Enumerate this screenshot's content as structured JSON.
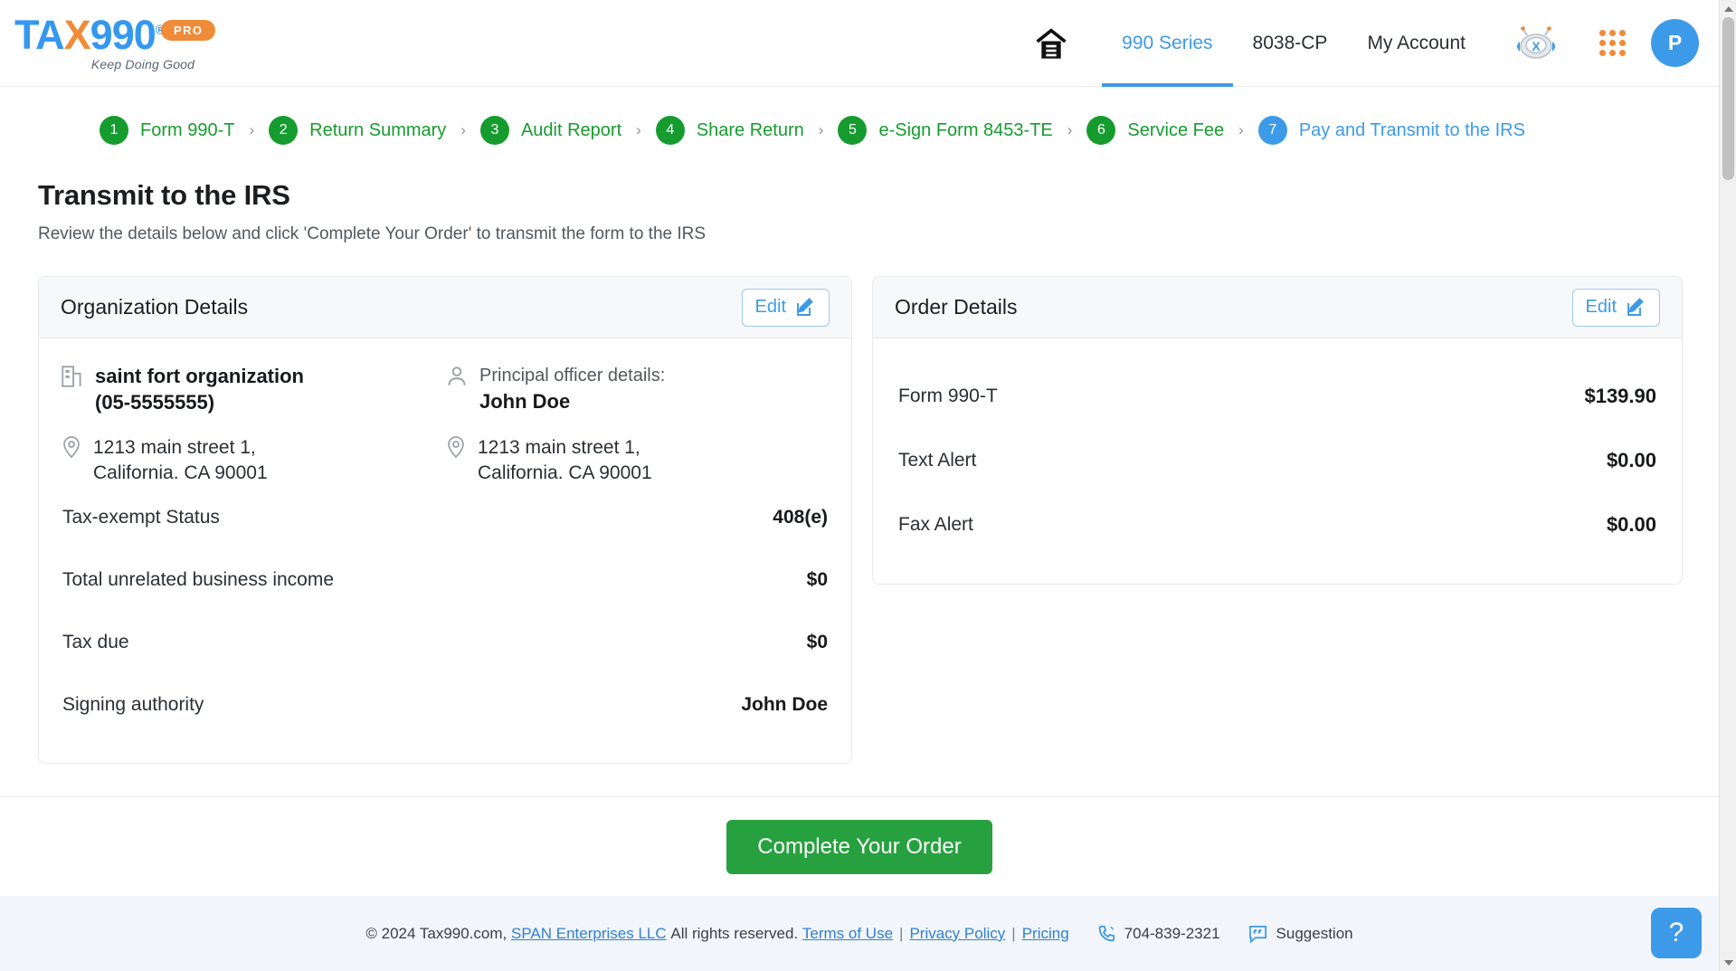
{
  "header": {
    "logo_text_1": "TA",
    "logo_text_x": "X",
    "logo_text_2": "990",
    "logo_reg": "®",
    "logo_tagline": "Keep Doing Good",
    "pro_badge": "PRO",
    "nav": [
      {
        "label": "990 Series",
        "active": true
      },
      {
        "label": "8038-CP",
        "active": false
      },
      {
        "label": "My Account",
        "active": false
      }
    ],
    "avatar_initial": "P",
    "home_icon": "home-icon",
    "bot_icon": "bot-assistant-icon",
    "apps_icon": "apps-grid-icon"
  },
  "stepper": {
    "steps": [
      {
        "number": "1",
        "label": "Form 990-T",
        "state": "done"
      },
      {
        "number": "2",
        "label": "Return Summary",
        "state": "done"
      },
      {
        "number": "3",
        "label": "Audit Report",
        "state": "done"
      },
      {
        "number": "4",
        "label": "Share Return",
        "state": "done"
      },
      {
        "number": "5",
        "label": "e-Sign Form 8453-TE",
        "state": "done"
      },
      {
        "number": "6",
        "label": "Service Fee",
        "state": "done"
      },
      {
        "number": "7",
        "label": "Pay and Transmit to the IRS",
        "state": "current"
      }
    ],
    "separator": "›"
  },
  "main": {
    "title": "Transmit to the IRS",
    "subtitle": "Review the details below and click 'Complete Your Order' to transmit the form to the IRS"
  },
  "organization_card": {
    "title": "Organization Details",
    "edit_label": "Edit",
    "org_name": "saint fort organization",
    "org_ein": "(05-5555555)",
    "org_address_line1": "1213 main street 1,",
    "org_address_line2": "California. CA 90001",
    "officer_label": "Principal officer details:",
    "officer_name": "John Doe",
    "officer_address_line1": "1213 main street 1,",
    "officer_address_line2": "California. CA 90001",
    "rows": [
      {
        "label": "Tax-exempt Status",
        "value": "408(e)"
      },
      {
        "label": "Total unrelated business income",
        "value": "$0"
      },
      {
        "label": "Tax due",
        "value": "$0"
      },
      {
        "label": "Signing authority",
        "value": "John Doe"
      }
    ]
  },
  "order_card": {
    "title": "Order Details",
    "edit_label": "Edit",
    "rows": [
      {
        "label": "Form 990-T",
        "value": "$139.90"
      },
      {
        "label": "Text Alert",
        "value": "$0.00"
      },
      {
        "label": "Fax Alert",
        "value": "$0.00"
      }
    ]
  },
  "actions": {
    "complete_label": "Complete Your Order"
  },
  "footer": {
    "copyright": "© 2024 Tax990.com,",
    "company_link": "SPAN Enterprises LLC",
    "rights": "All rights reserved.",
    "terms": "Terms of Use",
    "privacy": "Privacy Policy",
    "pricing": "Pricing",
    "sep": "|",
    "phone": "704-839-2321",
    "suggestion": "Suggestion",
    "help": "?"
  },
  "colors": {
    "brand_blue": "#3d9ae8",
    "brand_orange": "#ef8b39",
    "step_green": "#169c2e",
    "button_green": "#27a13f"
  }
}
